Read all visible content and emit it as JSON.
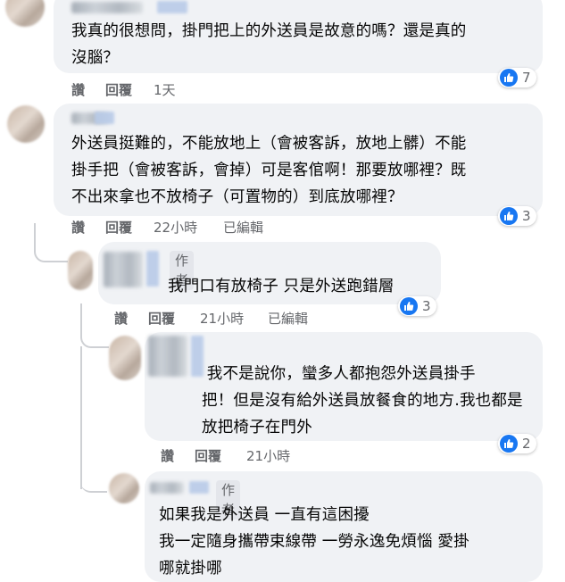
{
  "comments": [
    {
      "text": "我真的很想問，掛門把上的外送員是故意的嗎？還是真的\n沒腦？",
      "actions": {
        "like": "讚",
        "reply": "回覆",
        "time": "1天"
      },
      "reactions": "7"
    },
    {
      "text": "外送員挺難的，不能放地上（會被客訴，放地上髒）不能\n掛手把（會被客訴，會掉）可是客倌啊！那要放哪裡？既\n不出來拿也不放椅子（可置物的）到底放哪裡？",
      "actions": {
        "like": "讚",
        "reply": "回覆",
        "time": "22小時",
        "edited": "已編輯"
      },
      "reactions": "3"
    },
    {
      "author_tag": "作者",
      "text": "我門口有放椅子 只是外送跑錯層",
      "actions": {
        "like": "讚",
        "reply": "回覆",
        "time": "21小時",
        "edited": "已編輯"
      },
      "reactions": "3"
    },
    {
      "text": " 我不是說你，蠻多人都抱怨外送員掛手\n把！但是沒有給外送員放餐食的地方.我也都是\n放把椅子在門外",
      "actions": {
        "like": "讚",
        "reply": "回覆",
        "time": "21小時"
      },
      "reactions": "2"
    },
    {
      "author_tag": "作者",
      "text": "如果我是外送員 一直有這困擾\n我一定隨身攜帶束線帶 一勞永逸免煩惱 愛掛\n哪就掛哪"
    }
  ],
  "colors": {
    "bubble": "#f0f2f5",
    "like_blue": "#1877f2",
    "meta_gray": "#65676b"
  },
  "icons": {
    "reaction": "thumbs-up-icon"
  }
}
